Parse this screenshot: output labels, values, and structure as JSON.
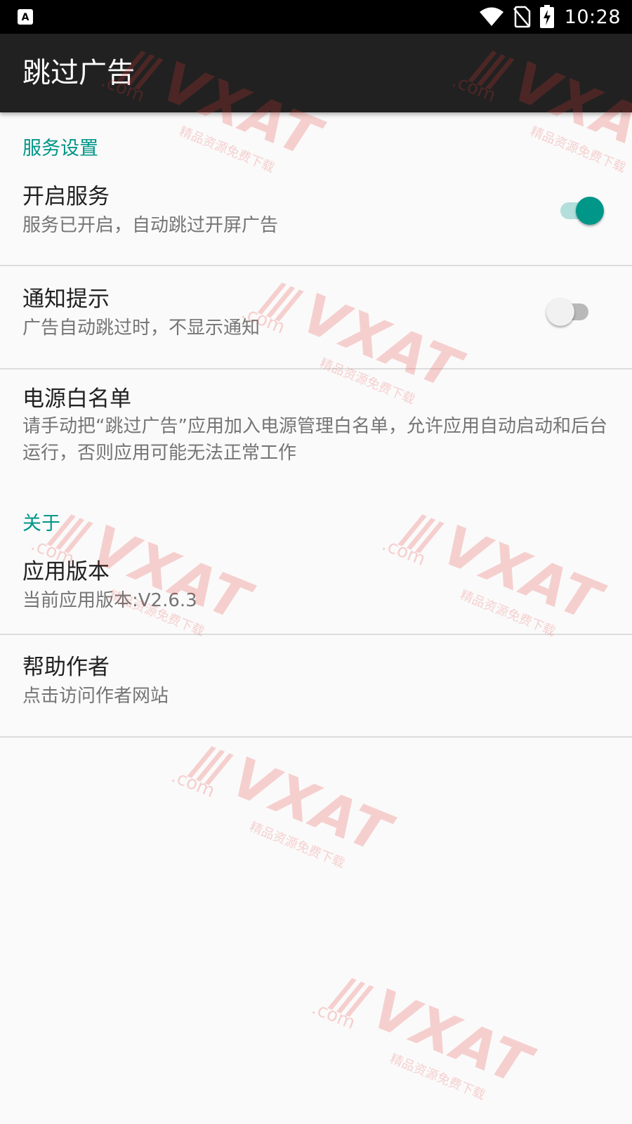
{
  "status_bar": {
    "time": "10:28",
    "left_icon": "accessibility-a-icon",
    "icons": [
      "wifi-icon",
      "no-sim-icon",
      "battery-charging-icon"
    ]
  },
  "app_bar": {
    "title": "跳过广告"
  },
  "sections": [
    {
      "header": "服务设置",
      "items": [
        {
          "title": "开启服务",
          "summary": "服务已开启，自动跳过开屏广告",
          "switch_on": true
        },
        {
          "title": "通知提示",
          "summary": "广告自动跳过时，不显示通知",
          "switch_on": false
        },
        {
          "title": "电源白名单",
          "summary": "请手动把“跳过广告”应用加入电源管理白名单，允许应用自动启动和后台运行，否则应用可能无法正常工作"
        }
      ]
    },
    {
      "header": "关于",
      "items": [
        {
          "title": "应用版本",
          "summary": "当前应用版本:V2.6.3"
        },
        {
          "title": "帮助作者",
          "summary": "点击访问作者网站"
        }
      ]
    }
  ],
  "watermark": {
    "brand": "VXAT",
    "domain": ".com",
    "tagline": "精品资源免费下载"
  },
  "colors": {
    "accent": "#009688",
    "app_bar": "#212121",
    "status_bar": "#000000",
    "background": "#fafafa",
    "watermark": "#e53935"
  }
}
